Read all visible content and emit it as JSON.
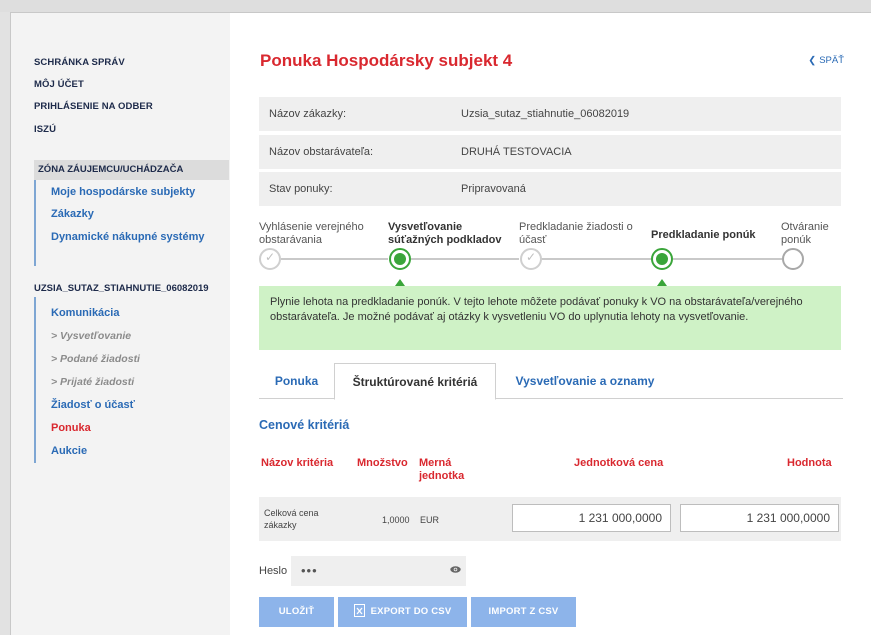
{
  "sidebar": {
    "links": [
      "SCHRÁNKA SPRÁV",
      "MÔJ ÚČET",
      "PRIHLÁSENIE NA ODBER",
      "ISZÚ"
    ],
    "zone_title": "ZÓNA ZÁUJEMCU/UCHÁDZAČA",
    "zone_items": [
      "Moje hospodárske subjekty",
      "Zákazky",
      "Dynamické nákupné systémy"
    ],
    "contract_title": "UZSIA_SUTAZ_STIAHNUTIE_06082019",
    "contract_items": [
      {
        "label": "Komunikácia"
      },
      {
        "label": "> Vysvetľovanie"
      },
      {
        "label": "> Podané žiadosti"
      },
      {
        "label": "> Prijaté žiadosti"
      },
      {
        "label": "Žiadosť o účasť"
      },
      {
        "label": "Ponuka"
      },
      {
        "label": "Aukcie"
      }
    ]
  },
  "header": {
    "title": "Ponuka Hospodársky subjekt 4",
    "back_label": "SPÄŤ"
  },
  "info": [
    {
      "label": "Názov zákazky:",
      "value": "Uzsia_sutaz_stiahnutie_06082019"
    },
    {
      "label": "Názov obstarávateľa:",
      "value": "DRUHÁ TESTOVACIA"
    },
    {
      "label": "Stav ponuky:",
      "value": "Pripravovaná"
    }
  ],
  "steps": [
    {
      "line1": "Vyhlásenie verejného",
      "line2": "obstarávania",
      "state": "done"
    },
    {
      "line1": "Vysvetľovanie",
      "line2": "súťažných podkladov",
      "state": "current"
    },
    {
      "line1": "Predkladanie žiadosti o",
      "line2": "účasť",
      "state": "done"
    },
    {
      "line1": "Predkladanie ponúk",
      "line2": "",
      "state": "current"
    },
    {
      "line1": "Otváranie",
      "line2": "ponúk",
      "state": "pending"
    }
  ],
  "notice": "Plynie lehota na predkladanie ponúk. V tejto lehote môžete podávať ponuky k VO na obstarávateľa/verejného obstarávateľa. Je možné podávať aj otázky k vysvetleniu VO do uplynutia lehoty na vysvetľovanie.",
  "tabs": [
    "Ponuka",
    "Štruktúrované kritériá",
    "Vysvetľovanie a oznamy"
  ],
  "section_title": "Cenové kritériá",
  "table": {
    "headers": {
      "name": "Názov kritéria",
      "qty": "Množstvo",
      "unit_line1": "Merná",
      "unit_line2": "jednotka",
      "unit_price": "Jednotková cena",
      "value": "Hodnota"
    },
    "row": {
      "name_line1": "Celková cena",
      "name_line2": "zákazky",
      "qty": "1,0000",
      "unit": "EUR",
      "unit_price": "1 231 000,0000",
      "value": "1 231 000,0000"
    }
  },
  "password": {
    "label": "Heslo",
    "value": "•••"
  },
  "buttons": {
    "save": "ULOŽIŤ",
    "export": "EXPORT DO CSV",
    "import": "IMPORT Z CSV"
  }
}
